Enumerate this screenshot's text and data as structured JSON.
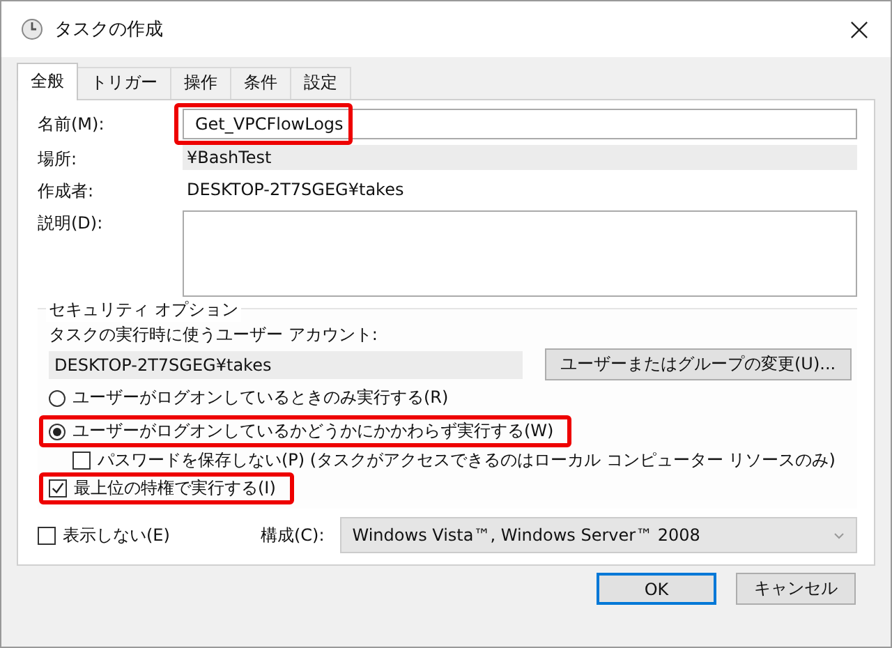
{
  "window": {
    "title": "タスクの作成"
  },
  "tabs": [
    {
      "label": "全般",
      "selected": true
    },
    {
      "label": "トリガー",
      "selected": false
    },
    {
      "label": "操作",
      "selected": false
    },
    {
      "label": "条件",
      "selected": false
    },
    {
      "label": "設定",
      "selected": false
    }
  ],
  "fields": [
    {
      "kind": "input",
      "label": "名前(M):",
      "value": "Get_VPCFlowLogs",
      "highlighted": true
    },
    {
      "kind": "readonly",
      "label": "場所:",
      "value": "¥BashTest",
      "highlighted": false
    },
    {
      "kind": "text",
      "label": "作成者:",
      "value": "DESKTOP-2T7SGEG¥takes",
      "highlighted": false
    },
    {
      "kind": "textarea",
      "label": "説明(D):",
      "highlighted": false
    }
  ],
  "security": {
    "legend": "セキュリティ オプション",
    "account_label": "タスクの実行時に使うユーザー アカウント:",
    "account": "DESKTOP-2T7SGEG¥takes",
    "change_button": "ユーザーまたはグループの変更(U)...",
    "options": [
      {
        "kind": "radio",
        "label": "ユーザーがログオンしているときのみ実行する(R)",
        "selected": false,
        "highlighted": false
      },
      {
        "kind": "radio",
        "label": "ユーザーがログオンしているかどうかにかかわらず実行する(W)",
        "selected": true,
        "highlighted": true,
        "children": [
          {
            "kind": "checkbox",
            "label": "パスワードを保存しない(P) (タスクがアクセスできるのはローカル コンピューター リソースのみ)",
            "checked": false
          }
        ]
      },
      {
        "kind": "checkbox",
        "label": "最上位の特権で実行する(I)",
        "checked": true,
        "highlighted": true
      }
    ]
  },
  "hidden": {
    "label": "表示しない(E)",
    "checked": false
  },
  "config": {
    "label": "構成(C):",
    "value": "Windows Vista™, Windows Server™ 2008"
  },
  "buttons": [
    {
      "label": "OK",
      "default": true
    },
    {
      "label": "キャンセル",
      "default": false
    }
  ]
}
